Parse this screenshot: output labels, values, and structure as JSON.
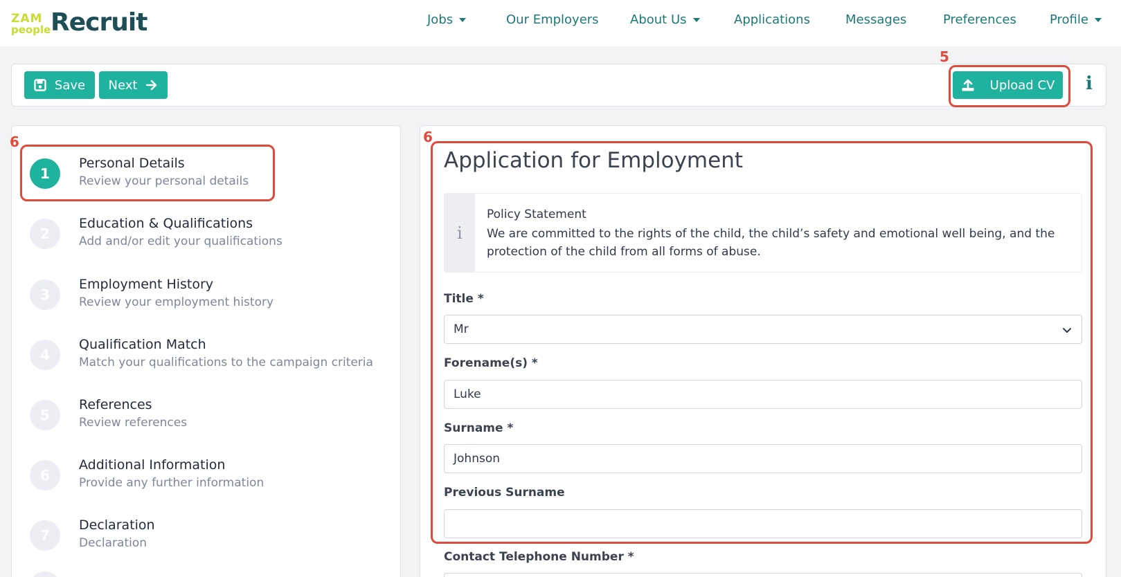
{
  "brand": {
    "logo_top": "ZAM",
    "logo_bottom": "people",
    "logo_text": "Recruit",
    "logo_color": "#c8dc32",
    "accent": "#1fb29f",
    "annotation_color": "#e04a3a"
  },
  "nav": {
    "items": [
      {
        "label": "Jobs",
        "has_caret": true
      },
      {
        "label": "Our Employers",
        "has_caret": false
      },
      {
        "label": "About Us",
        "has_caret": true
      },
      {
        "label": "Applications",
        "has_caret": false
      },
      {
        "label": "Messages",
        "has_caret": false
      },
      {
        "label": "Preferences",
        "has_caret": false
      },
      {
        "label": "Profile",
        "has_caret": true
      }
    ]
  },
  "toolbar": {
    "save_label": "Save",
    "save_icon": "floppy-disk-icon",
    "next_label": "Next",
    "next_icon": "arrow-right-icon",
    "upload_label": "Upload CV",
    "upload_icon": "upload-icon",
    "info_glyph": "i"
  },
  "annotations": {
    "upload_number": "5",
    "steps_number": "6",
    "form_number": "6"
  },
  "steps": [
    {
      "number": "1",
      "title": "Personal Details",
      "desc": "Review your personal details",
      "active": true
    },
    {
      "number": "2",
      "title": "Education & Qualifications",
      "desc": "Add and/or edit your qualifications",
      "active": false
    },
    {
      "number": "3",
      "title": "Employment History",
      "desc": "Review your employment history",
      "active": false
    },
    {
      "number": "4",
      "title": "Qualification Match",
      "desc": "Match your qualifications to the campaign criteria",
      "active": false
    },
    {
      "number": "5",
      "title": "References",
      "desc": "Review references",
      "active": false
    },
    {
      "number": "6",
      "title": "Additional Information",
      "desc": "Provide any further information",
      "active": false
    },
    {
      "number": "7",
      "title": "Declaration",
      "desc": "Declaration",
      "active": false
    }
  ],
  "form": {
    "title": "Application for Employment",
    "policy": {
      "icon_glyph": "i",
      "title": "Policy Statement",
      "text": "We are committed to the rights of the child, the child’s safety and emotional well being, and the protection of the child from all forms of abuse."
    },
    "fields": {
      "title": {
        "label": "Title *",
        "value": "Mr"
      },
      "forename": {
        "label": "Forename(s) *",
        "value": "Luke"
      },
      "surname": {
        "label": "Surname *",
        "value": "Johnson"
      },
      "previous_surname": {
        "label": "Previous Surname",
        "value": ""
      },
      "telephone": {
        "label": "Contact Telephone Number *",
        "value": ""
      }
    }
  }
}
